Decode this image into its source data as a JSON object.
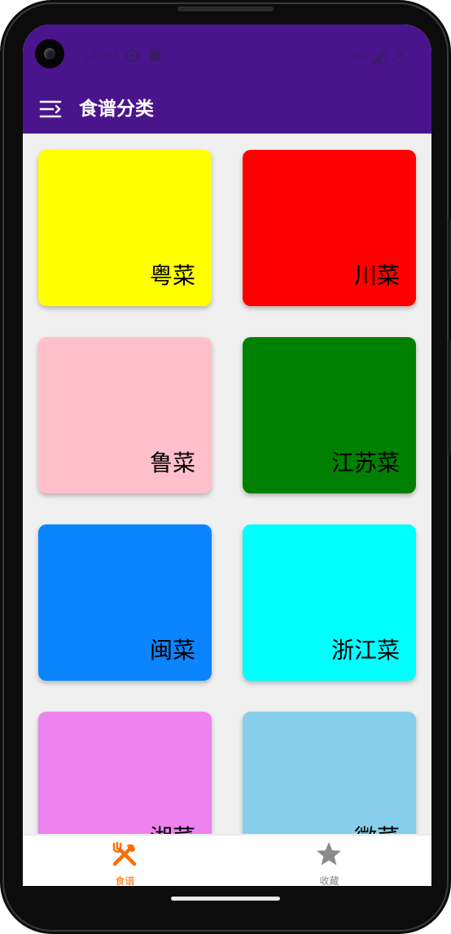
{
  "status_bar": {
    "time": "12:53",
    "network": "3G"
  },
  "toolbar": {
    "title": "食谱分类",
    "menu_icon": "menu-icon"
  },
  "categories": [
    {
      "label": "粤菜",
      "color": "#ffff00"
    },
    {
      "label": "川菜",
      "color": "#ff0000"
    },
    {
      "label": "鲁菜",
      "color": "#ffc0cb"
    },
    {
      "label": "江苏菜",
      "color": "#008000"
    },
    {
      "label": "闽菜",
      "color": "#0a84ff"
    },
    {
      "label": "浙江菜",
      "color": "#00ffff"
    },
    {
      "label": "湘菜",
      "color": "#ee82ee"
    },
    {
      "label": "徽菜",
      "color": "#87ceeb"
    }
  ],
  "bottom_nav": {
    "items": [
      {
        "label": "食谱",
        "icon": "utensils-icon",
        "active": true,
        "color": "#ff6d00"
      },
      {
        "label": "收藏",
        "icon": "star-icon",
        "active": false,
        "color": "#8a8a8a"
      }
    ]
  },
  "colors": {
    "primary": "#4a148c",
    "background": "#f0f0f0",
    "accent": "#ff6d00"
  }
}
